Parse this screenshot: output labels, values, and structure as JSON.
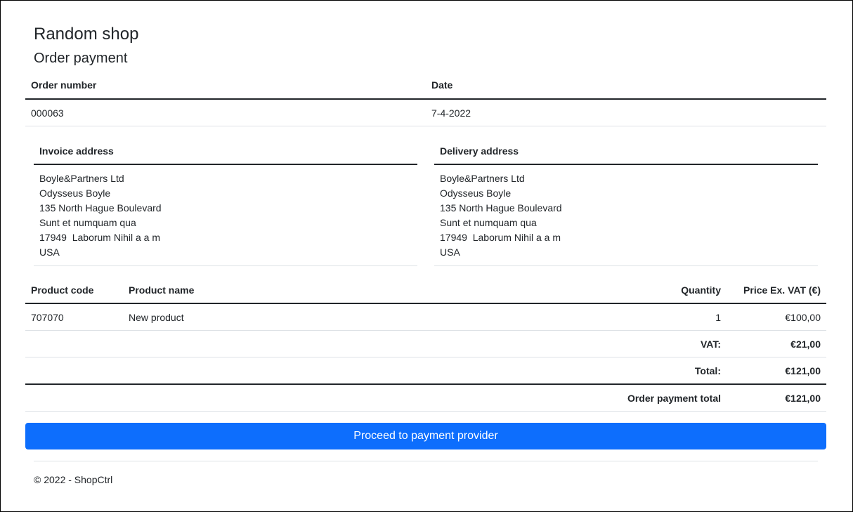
{
  "header": {
    "shop_name": "Random shop",
    "page_title": "Order payment"
  },
  "order": {
    "number_label": "Order number",
    "date_label": "Date",
    "number": "000063",
    "date": "7-4-2022"
  },
  "invoice_address": {
    "label": "Invoice address",
    "lines": [
      "Boyle&Partners Ltd",
      "Odysseus Boyle",
      "135 North Hague Boulevard",
      "Sunt et numquam qua",
      "17949  Laborum Nihil a a m",
      "USA"
    ]
  },
  "delivery_address": {
    "label": "Delivery address",
    "lines": [
      "Boyle&Partners Ltd",
      "Odysseus Boyle",
      "135 North Hague Boulevard",
      "Sunt et numquam qua",
      "17949  Laborum Nihil a a m",
      "USA"
    ]
  },
  "products": {
    "headers": {
      "code": "Product code",
      "name": "Product name",
      "quantity": "Quantity",
      "price": "Price Ex. VAT (€)"
    },
    "rows": [
      {
        "code": "707070",
        "name": "New product",
        "quantity": "1",
        "price": "€100,00"
      }
    ],
    "vat_label": "VAT:",
    "vat_value": "€21,00",
    "total_label": "Total:",
    "total_value": "€121,00",
    "payment_total_label": "Order payment total",
    "payment_total_value": "€121,00"
  },
  "actions": {
    "proceed_label": "Proceed to payment provider"
  },
  "footer": {
    "copyright": "© 2022 - ShopCtrl"
  },
  "colors": {
    "primary": "#0d6efd",
    "text": "#212529",
    "divider": "#dee2e6"
  }
}
